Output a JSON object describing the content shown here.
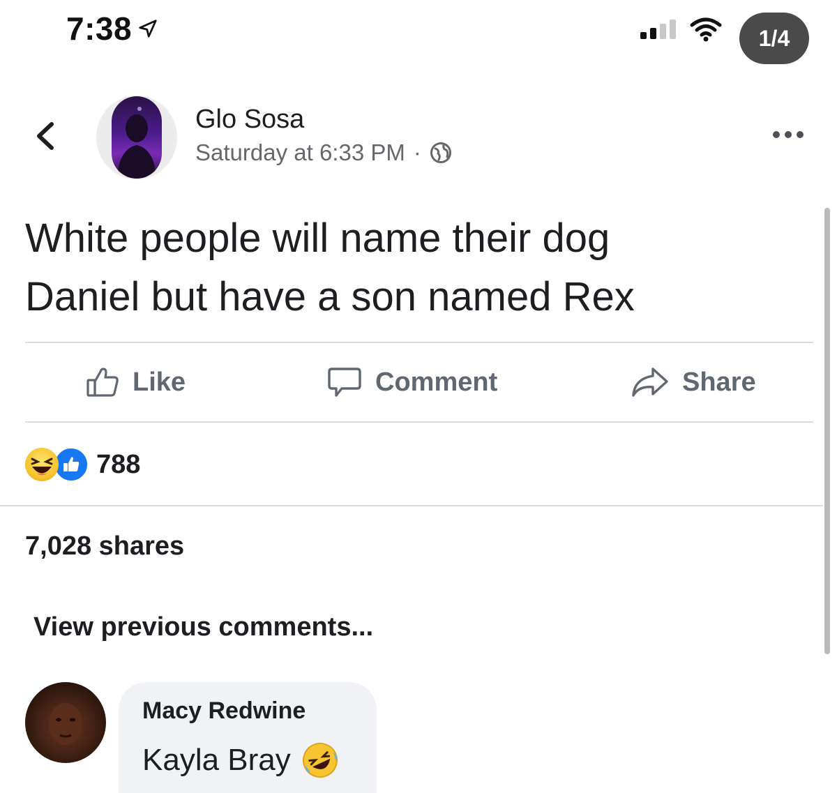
{
  "status_bar": {
    "time": "7:38",
    "page_indicator": "1/4"
  },
  "post": {
    "author": "Glo Sosa",
    "timestamp": "Saturday at 6:33 PM",
    "separator": "·",
    "privacy_icon": "globe-icon",
    "text_line1": "White people will name their dog",
    "text_line2": "Daniel but have a son named Rex"
  },
  "actions": {
    "like": "Like",
    "comment": "Comment",
    "share": "Share"
  },
  "reactions": {
    "count": "788",
    "types": [
      "haha",
      "like"
    ]
  },
  "shares": "7,028 shares",
  "comments": {
    "view_previous": "View previous comments...",
    "items": [
      {
        "author": "Macy Redwine",
        "text": "Kayla Bray"
      }
    ]
  },
  "colors": {
    "like_blue": "#1877f2",
    "secondary_text": "#65676b",
    "bubble_bg": "#f0f2f5"
  }
}
